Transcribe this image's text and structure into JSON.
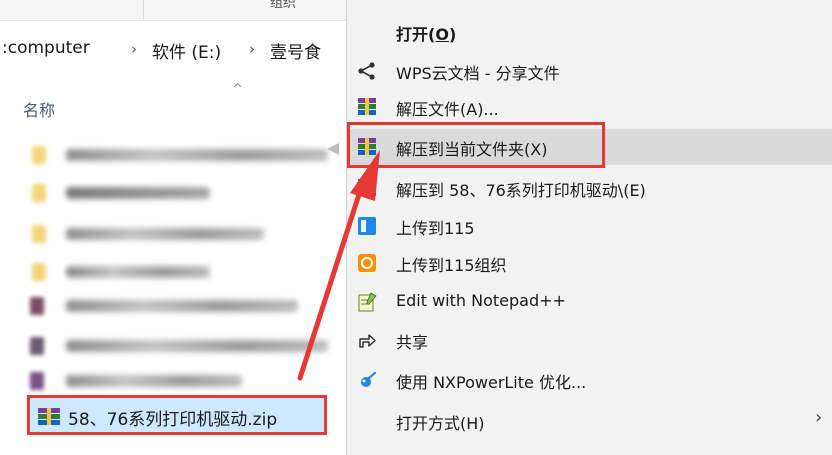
{
  "explorer": {
    "top_strip_text": "组织",
    "breadcrumb": [
      ":computer",
      "软件 (E:)",
      "壹号食"
    ],
    "breadcrumb_separator": "›",
    "column_header": "名称",
    "sort_indicator": "^",
    "selected_file": {
      "name": "58、76系列打印机驱动.zip",
      "icon": "winrar-archive-icon"
    }
  },
  "context_menu": {
    "items": [
      {
        "id": "open",
        "label": "打开",
        "accel": "O",
        "icon": "",
        "bold": true
      },
      {
        "id": "wps-share",
        "label": "WPS云文档 - 分享文件",
        "icon": "share-icon"
      },
      {
        "id": "extract-files",
        "label": "解压文件(A)...",
        "icon": "winrar-archive-icon"
      },
      {
        "id": "extract-here",
        "label": "解压到当前文件夹(X)",
        "icon": "winrar-archive-icon",
        "highlighted": true
      },
      {
        "id": "extract-to",
        "label": "解压到 58、76系列打印机驱动\\(E)",
        "icon": "winrar-archive-icon"
      },
      {
        "id": "upload-115",
        "label": "上传到115",
        "icon": "115-icon"
      },
      {
        "id": "upload-115-org",
        "label": "上传到115组织",
        "icon": "115-org-icon"
      },
      {
        "id": "notepad",
        "label": "Edit with Notepad++",
        "icon": "notepad-plus-icon"
      },
      {
        "id": "share",
        "label": "共享",
        "icon": "share-arrow-icon"
      },
      {
        "id": "nxpowerlite",
        "label": "使用 NXPowerLite 优化...",
        "icon": "nxpowerlite-icon"
      },
      {
        "id": "open-with",
        "label": "打开方式(H)",
        "icon": "",
        "has_submenu": true
      }
    ],
    "submenu_arrow": "›"
  },
  "colors": {
    "highlight_red": "#e53935",
    "selection_blue": "#cde8ff",
    "menu_bg": "#f2f2f2",
    "menu_hover": "#dadada"
  }
}
